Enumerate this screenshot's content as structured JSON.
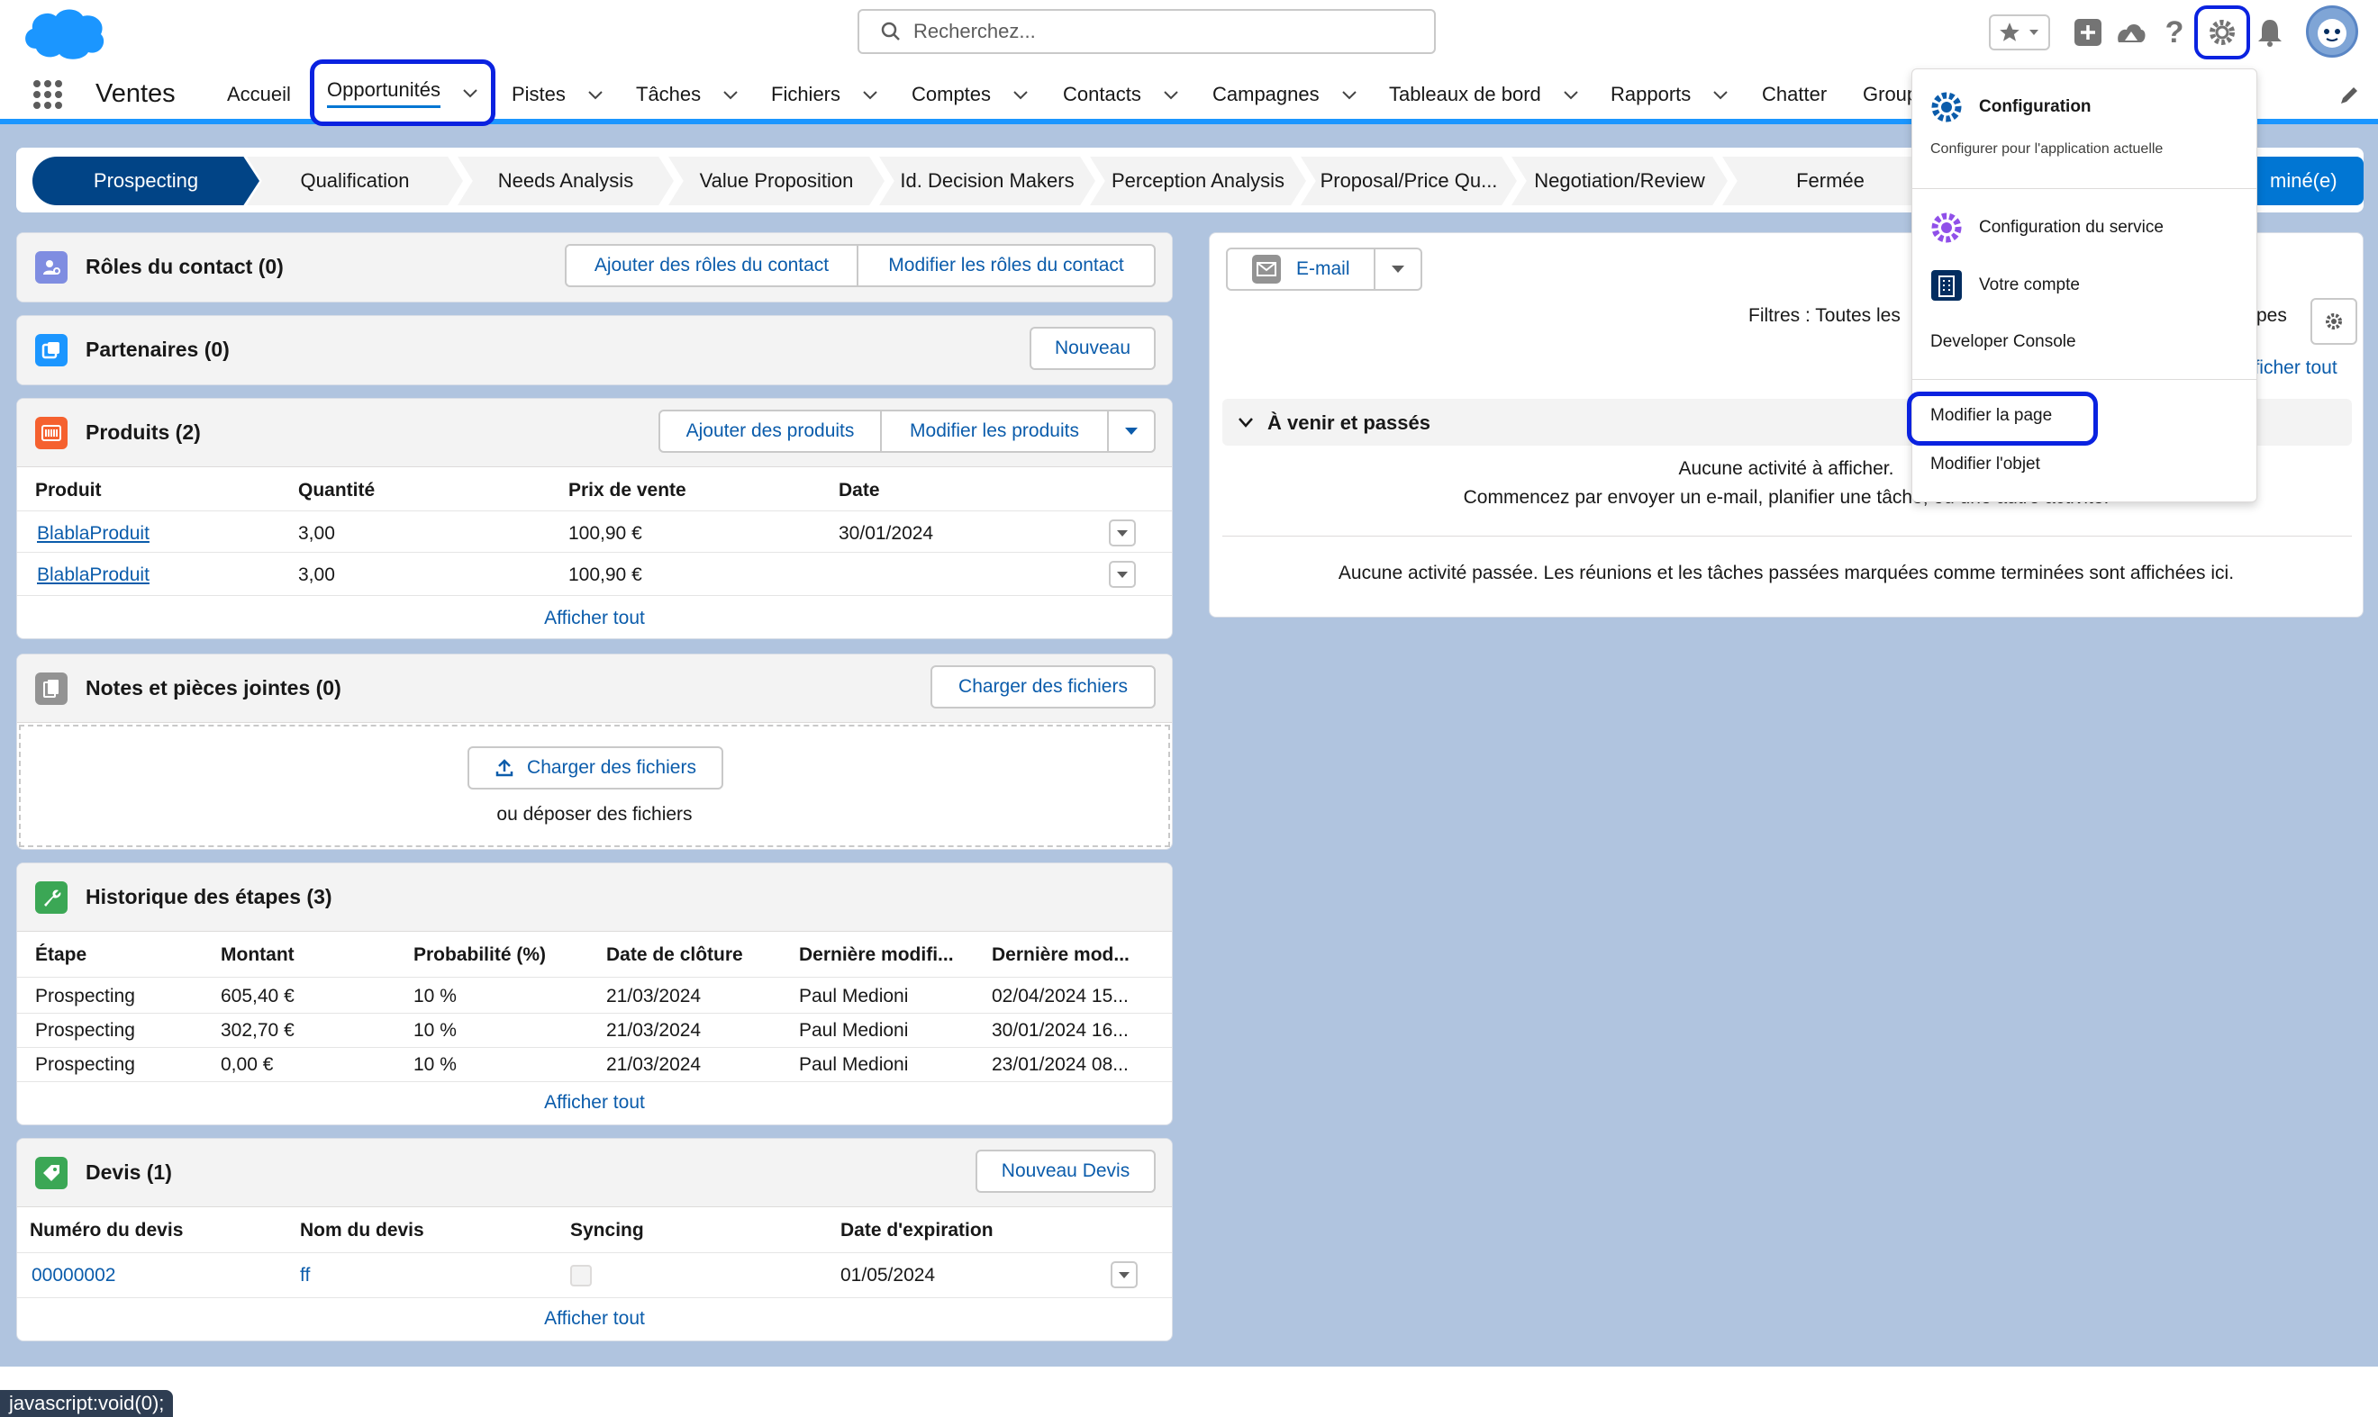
{
  "header": {
    "search_placeholder": "Recherchez..."
  },
  "nav": {
    "app_name": "Ventes",
    "items": [
      {
        "label": "Accueil"
      },
      {
        "label": "Opportunités"
      },
      {
        "label": "Pistes"
      },
      {
        "label": "Tâches"
      },
      {
        "label": "Fichiers"
      },
      {
        "label": "Comptes"
      },
      {
        "label": "Contacts"
      },
      {
        "label": "Campagnes"
      },
      {
        "label": "Tableaux de bord"
      },
      {
        "label": "Rapports"
      },
      {
        "label": "Chatter"
      },
      {
        "label": "Group"
      }
    ]
  },
  "path": {
    "steps": [
      "Prospecting",
      "Qualification",
      "Needs Analysis",
      "Value Proposition",
      "Id. Decision Makers",
      "Perception Analysis",
      "Proposal/Price Qu...",
      "Negotiation/Review",
      "Fermée"
    ],
    "complete_label": "miné(e)"
  },
  "contact_roles": {
    "title": "Rôles du contact (0)",
    "add_label": "Ajouter des rôles du contact",
    "edit_label": "Modifier les rôles du contact"
  },
  "partners": {
    "title": "Partenaires (0)",
    "new_label": "Nouveau"
  },
  "products": {
    "title": "Produits (2)",
    "add_label": "Ajouter des produits",
    "edit_label": "Modifier les produits",
    "columns": [
      "Produit",
      "Quantité",
      "Prix de vente",
      "Date"
    ],
    "rows": [
      {
        "product": "BlablaProduit",
        "qty": "3,00",
        "price": "100,90 €",
        "date": "30/01/2024"
      },
      {
        "product": "BlablaProduit",
        "qty": "3,00",
        "price": "100,90 €",
        "date": ""
      }
    ],
    "view_all": "Afficher tout"
  },
  "notes": {
    "title": "Notes et pièces jointes (0)",
    "upload_label": "Charger des fichiers",
    "upload_inner_label": "Charger des fichiers",
    "drop_text": "ou déposer des fichiers"
  },
  "stage_history": {
    "title": "Historique des étapes (3)",
    "columns": [
      "Étape",
      "Montant",
      "Probabilité (%)",
      "Date de clôture",
      "Dernière modifi...",
      "Dernière mod..."
    ],
    "rows": [
      {
        "stage": "Prospecting",
        "amount": "605,40 €",
        "prob": "10 %",
        "close": "21/03/2024",
        "by": "Paul Medioni",
        "modified": "02/04/2024 15..."
      },
      {
        "stage": "Prospecting",
        "amount": "302,70 €",
        "prob": "10 %",
        "close": "21/03/2024",
        "by": "Paul Medioni",
        "modified": "30/01/2024 16..."
      },
      {
        "stage": "Prospecting",
        "amount": "0,00 €",
        "prob": "10 %",
        "close": "21/03/2024",
        "by": "Paul Medioni",
        "modified": "23/01/2024 08..."
      }
    ],
    "view_all": "Afficher tout"
  },
  "quotes": {
    "title": "Devis (1)",
    "new_label": "Nouveau Devis",
    "columns": [
      "Numéro du devis",
      "Nom du devis",
      "Syncing",
      "Date d'expiration"
    ],
    "rows": [
      {
        "number": "00000002",
        "name": "ff",
        "expiration": "01/05/2024"
      }
    ],
    "view_all": "Afficher tout"
  },
  "activity": {
    "email_label": "E-mail",
    "filters_text": "Filtres : Toutes les",
    "filters_text_right": "pes",
    "view_all": "fficher tout",
    "upcoming_title": "À venir et passés",
    "no_activity": "Aucune activité à afficher.",
    "no_activity_hint": "Commencez par envoyer un e-mail, planifier une tâche, ou une autre activité.",
    "past_text": "Aucune activité passée. Les réunions et les tâches passées marquées comme terminées sont affichées ici."
  },
  "setup_menu": {
    "configuration_title": "Configuration",
    "configuration_sub": "Configurer pour l'application actuelle",
    "service_setup": "Configuration du service",
    "your_account": "Votre compte",
    "developer_console": "Developer Console",
    "edit_page": "Modifier la page",
    "edit_object": "Modifier l'objet"
  },
  "status_bar": {
    "text": "javascript:void(0);"
  },
  "colors": {
    "brand_blue": "#0176d3",
    "path_active": "#014486",
    "highlight_ring": "#0a22e0",
    "page_bg": "#b0c4df"
  }
}
